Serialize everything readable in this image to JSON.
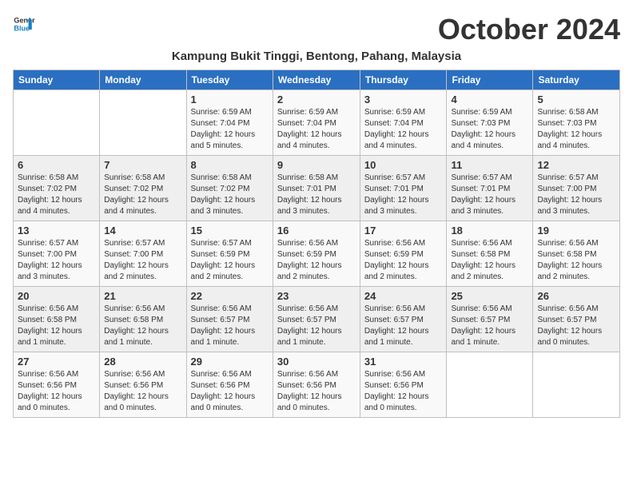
{
  "logo": {
    "line1": "General",
    "line2": "Blue"
  },
  "title": "October 2024",
  "location": "Kampung Bukit Tinggi, Bentong, Pahang, Malaysia",
  "weekdays": [
    "Sunday",
    "Monday",
    "Tuesday",
    "Wednesday",
    "Thursday",
    "Friday",
    "Saturday"
  ],
  "weeks": [
    [
      {
        "day": "",
        "sunrise": "",
        "sunset": "",
        "daylight": ""
      },
      {
        "day": "",
        "sunrise": "",
        "sunset": "",
        "daylight": ""
      },
      {
        "day": "1",
        "sunrise": "Sunrise: 6:59 AM",
        "sunset": "Sunset: 7:04 PM",
        "daylight": "Daylight: 12 hours and 5 minutes."
      },
      {
        "day": "2",
        "sunrise": "Sunrise: 6:59 AM",
        "sunset": "Sunset: 7:04 PM",
        "daylight": "Daylight: 12 hours and 4 minutes."
      },
      {
        "day": "3",
        "sunrise": "Sunrise: 6:59 AM",
        "sunset": "Sunset: 7:04 PM",
        "daylight": "Daylight: 12 hours and 4 minutes."
      },
      {
        "day": "4",
        "sunrise": "Sunrise: 6:59 AM",
        "sunset": "Sunset: 7:03 PM",
        "daylight": "Daylight: 12 hours and 4 minutes."
      },
      {
        "day": "5",
        "sunrise": "Sunrise: 6:58 AM",
        "sunset": "Sunset: 7:03 PM",
        "daylight": "Daylight: 12 hours and 4 minutes."
      }
    ],
    [
      {
        "day": "6",
        "sunrise": "Sunrise: 6:58 AM",
        "sunset": "Sunset: 7:02 PM",
        "daylight": "Daylight: 12 hours and 4 minutes."
      },
      {
        "day": "7",
        "sunrise": "Sunrise: 6:58 AM",
        "sunset": "Sunset: 7:02 PM",
        "daylight": "Daylight: 12 hours and 4 minutes."
      },
      {
        "day": "8",
        "sunrise": "Sunrise: 6:58 AM",
        "sunset": "Sunset: 7:02 PM",
        "daylight": "Daylight: 12 hours and 3 minutes."
      },
      {
        "day": "9",
        "sunrise": "Sunrise: 6:58 AM",
        "sunset": "Sunset: 7:01 PM",
        "daylight": "Daylight: 12 hours and 3 minutes."
      },
      {
        "day": "10",
        "sunrise": "Sunrise: 6:57 AM",
        "sunset": "Sunset: 7:01 PM",
        "daylight": "Daylight: 12 hours and 3 minutes."
      },
      {
        "day": "11",
        "sunrise": "Sunrise: 6:57 AM",
        "sunset": "Sunset: 7:01 PM",
        "daylight": "Daylight: 12 hours and 3 minutes."
      },
      {
        "day": "12",
        "sunrise": "Sunrise: 6:57 AM",
        "sunset": "Sunset: 7:00 PM",
        "daylight": "Daylight: 12 hours and 3 minutes."
      }
    ],
    [
      {
        "day": "13",
        "sunrise": "Sunrise: 6:57 AM",
        "sunset": "Sunset: 7:00 PM",
        "daylight": "Daylight: 12 hours and 3 minutes."
      },
      {
        "day": "14",
        "sunrise": "Sunrise: 6:57 AM",
        "sunset": "Sunset: 7:00 PM",
        "daylight": "Daylight: 12 hours and 2 minutes."
      },
      {
        "day": "15",
        "sunrise": "Sunrise: 6:57 AM",
        "sunset": "Sunset: 6:59 PM",
        "daylight": "Daylight: 12 hours and 2 minutes."
      },
      {
        "day": "16",
        "sunrise": "Sunrise: 6:56 AM",
        "sunset": "Sunset: 6:59 PM",
        "daylight": "Daylight: 12 hours and 2 minutes."
      },
      {
        "day": "17",
        "sunrise": "Sunrise: 6:56 AM",
        "sunset": "Sunset: 6:59 PM",
        "daylight": "Daylight: 12 hours and 2 minutes."
      },
      {
        "day": "18",
        "sunrise": "Sunrise: 6:56 AM",
        "sunset": "Sunset: 6:58 PM",
        "daylight": "Daylight: 12 hours and 2 minutes."
      },
      {
        "day": "19",
        "sunrise": "Sunrise: 6:56 AM",
        "sunset": "Sunset: 6:58 PM",
        "daylight": "Daylight: 12 hours and 2 minutes."
      }
    ],
    [
      {
        "day": "20",
        "sunrise": "Sunrise: 6:56 AM",
        "sunset": "Sunset: 6:58 PM",
        "daylight": "Daylight: 12 hours and 1 minute."
      },
      {
        "day": "21",
        "sunrise": "Sunrise: 6:56 AM",
        "sunset": "Sunset: 6:58 PM",
        "daylight": "Daylight: 12 hours and 1 minute."
      },
      {
        "day": "22",
        "sunrise": "Sunrise: 6:56 AM",
        "sunset": "Sunset: 6:57 PM",
        "daylight": "Daylight: 12 hours and 1 minute."
      },
      {
        "day": "23",
        "sunrise": "Sunrise: 6:56 AM",
        "sunset": "Sunset: 6:57 PM",
        "daylight": "Daylight: 12 hours and 1 minute."
      },
      {
        "day": "24",
        "sunrise": "Sunrise: 6:56 AM",
        "sunset": "Sunset: 6:57 PM",
        "daylight": "Daylight: 12 hours and 1 minute."
      },
      {
        "day": "25",
        "sunrise": "Sunrise: 6:56 AM",
        "sunset": "Sunset: 6:57 PM",
        "daylight": "Daylight: 12 hours and 1 minute."
      },
      {
        "day": "26",
        "sunrise": "Sunrise: 6:56 AM",
        "sunset": "Sunset: 6:57 PM",
        "daylight": "Daylight: 12 hours and 0 minutes."
      }
    ],
    [
      {
        "day": "27",
        "sunrise": "Sunrise: 6:56 AM",
        "sunset": "Sunset: 6:56 PM",
        "daylight": "Daylight: 12 hours and 0 minutes."
      },
      {
        "day": "28",
        "sunrise": "Sunrise: 6:56 AM",
        "sunset": "Sunset: 6:56 PM",
        "daylight": "Daylight: 12 hours and 0 minutes."
      },
      {
        "day": "29",
        "sunrise": "Sunrise: 6:56 AM",
        "sunset": "Sunset: 6:56 PM",
        "daylight": "Daylight: 12 hours and 0 minutes."
      },
      {
        "day": "30",
        "sunrise": "Sunrise: 6:56 AM",
        "sunset": "Sunset: 6:56 PM",
        "daylight": "Daylight: 12 hours and 0 minutes."
      },
      {
        "day": "31",
        "sunrise": "Sunrise: 6:56 AM",
        "sunset": "Sunset: 6:56 PM",
        "daylight": "Daylight: 12 hours and 0 minutes."
      },
      {
        "day": "",
        "sunrise": "",
        "sunset": "",
        "daylight": ""
      },
      {
        "day": "",
        "sunrise": "",
        "sunset": "",
        "daylight": ""
      }
    ]
  ]
}
